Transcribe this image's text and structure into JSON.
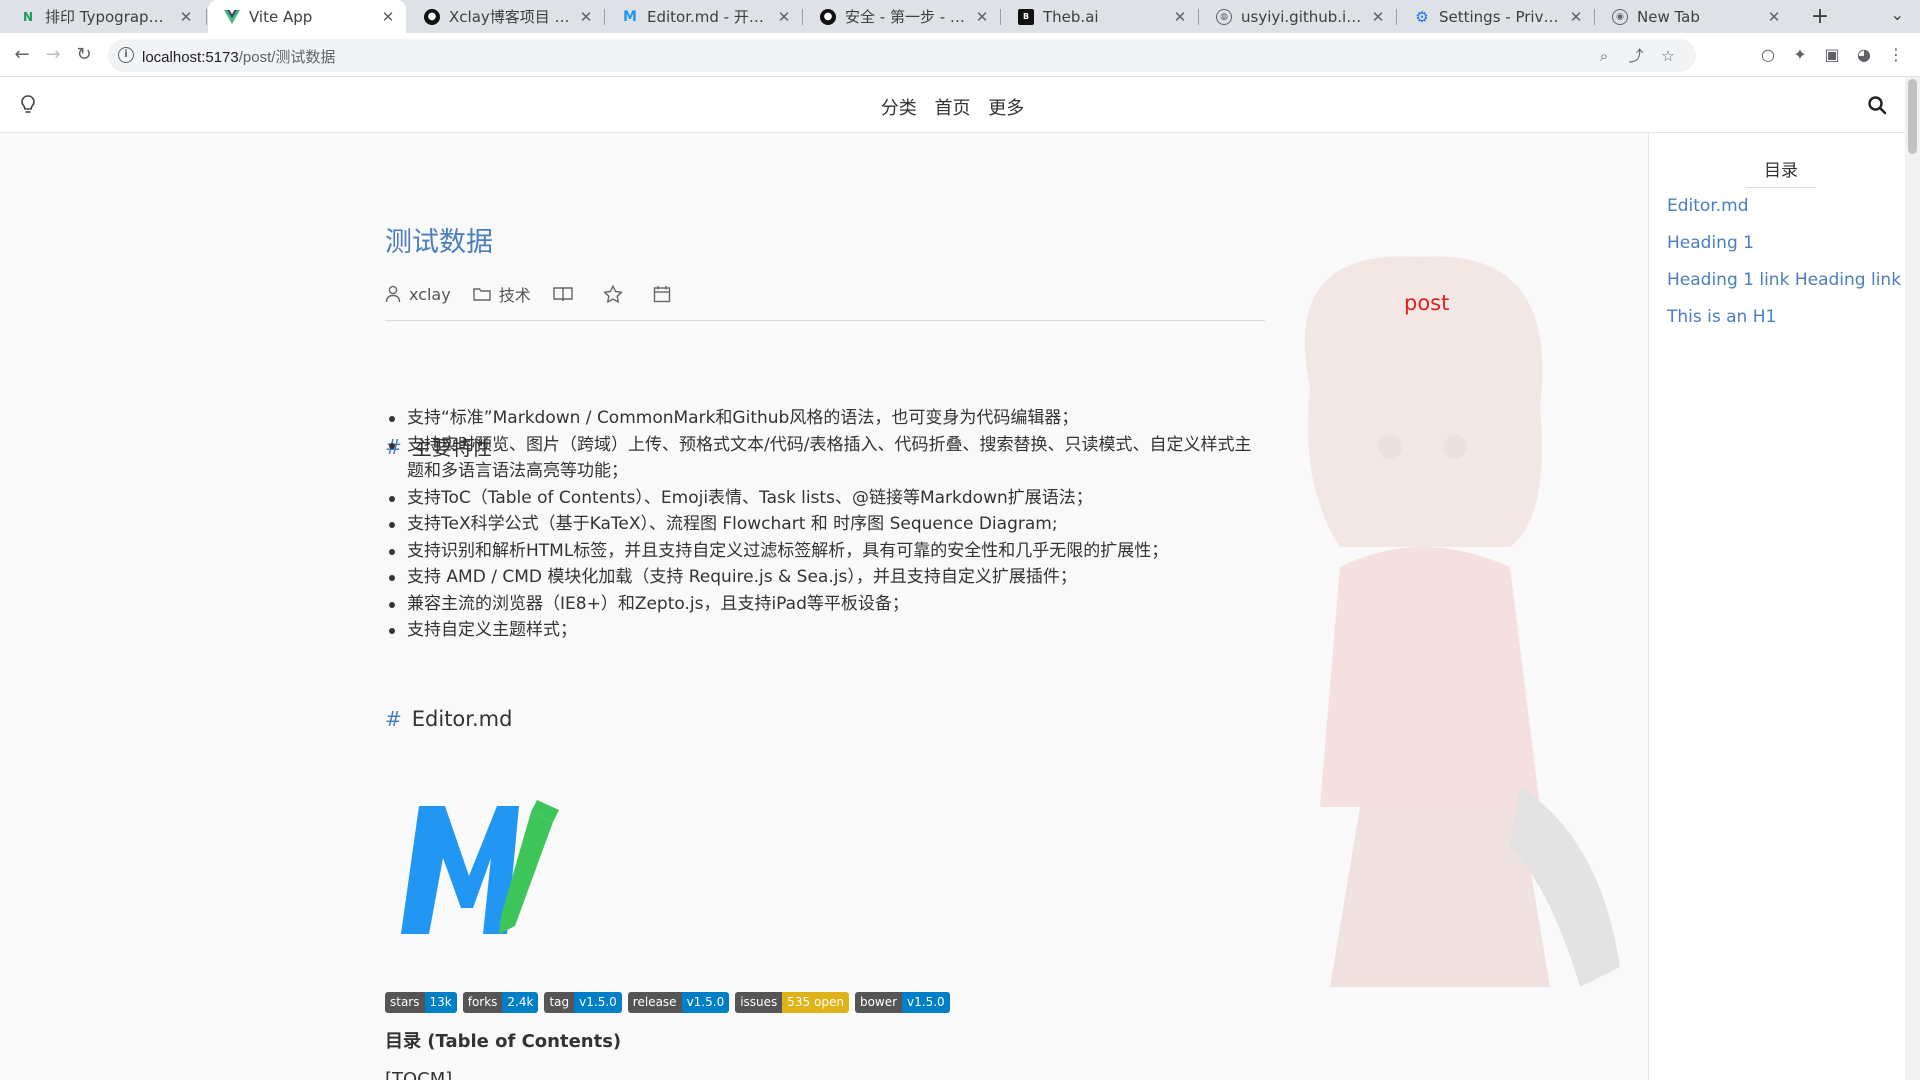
{
  "browser": {
    "tabs": [
      {
        "title": "排印 Typography - Naive UI",
        "icon": "naive-ui-icon",
        "active": false
      },
      {
        "title": "Vite App",
        "icon": "vue-icon",
        "active": true
      },
      {
        "title": "Xclay博客项目 - Swagger",
        "icon": "github-icon",
        "active": false
      },
      {
        "title": "Editor.md - 开源在线 Markdown 编辑器",
        "icon": "editormd-icon",
        "active": false
      },
      {
        "title": "安全 - 第一步 - FastAPI",
        "icon": "github-icon",
        "active": false
      },
      {
        "title": "Theb.ai",
        "icon": "theb-icon",
        "active": false
      },
      {
        "title": "usyiyi.github.io/sqlalchemy",
        "icon": "globe-icon",
        "active": false
      },
      {
        "title": "Settings - Privacy and security",
        "icon": "settings-icon",
        "active": false
      },
      {
        "title": "New Tab",
        "icon": "chrome-icon",
        "active": false
      }
    ],
    "url_host": "localhost:5173",
    "url_path": "/post/测试数据"
  },
  "nav": {
    "links": [
      "分类",
      "首页",
      "更多"
    ]
  },
  "post": {
    "label": "post",
    "title": "测试数据",
    "author": "xclay",
    "category": "技术",
    "section1_title": "主要特性",
    "features": [
      "支持“标准”Markdown / CommonMark和Github风格的语法，也可变身为代码编辑器；",
      "支持实时预览、图片（跨域）上传、预格式文本/代码/表格插入、代码折叠、搜索替换、只读模式、自定义样式主题和多语言语法高亮等功能；",
      "支持ToC（Table of Contents）、Emoji表情、Task lists、@链接等Markdown扩展语法；",
      "支持TeX科学公式（基于KaTeX）、流程图 Flowchart 和 时序图 Sequence Diagram;",
      "支持识别和解析HTML标签，并且支持自定义过滤标签解析，具有可靠的安全性和几乎无限的扩展性；",
      "支持 AMD / CMD 模块化加载（支持 Require.js & Sea.js），并且支持自定义扩展插件；",
      "兼容主流的浏览器（IE8+）和Zepto.js，且支持iPad等平板设备；",
      "支持自定义主题样式；"
    ],
    "section2_title": "Editor.md",
    "badges": [
      {
        "key": "stars",
        "value": "13k",
        "color": "#007ec6"
      },
      {
        "key": "forks",
        "value": "2.4k",
        "color": "#007ec6"
      },
      {
        "key": "tag",
        "value": "v1.5.0",
        "color": "#007ec6"
      },
      {
        "key": "release",
        "value": "v1.5.0",
        "color": "#007ec6"
      },
      {
        "key": "issues",
        "value": "535 open",
        "color": "#dfb317"
      },
      {
        "key": "bower",
        "value": "v1.5.0",
        "color": "#007ec6"
      }
    ],
    "toc_heading": "目录 (Table of Contents)",
    "tocm": "[TOCM]"
  },
  "sidebar": {
    "title": "目录",
    "items": [
      "Editor.md",
      "Heading 1",
      "Heading 1 link Heading link",
      "This is an H1"
    ]
  },
  "colors": {
    "accent": "#4b7ec0",
    "post_label": "#e02020",
    "badge_key": "#555555"
  }
}
